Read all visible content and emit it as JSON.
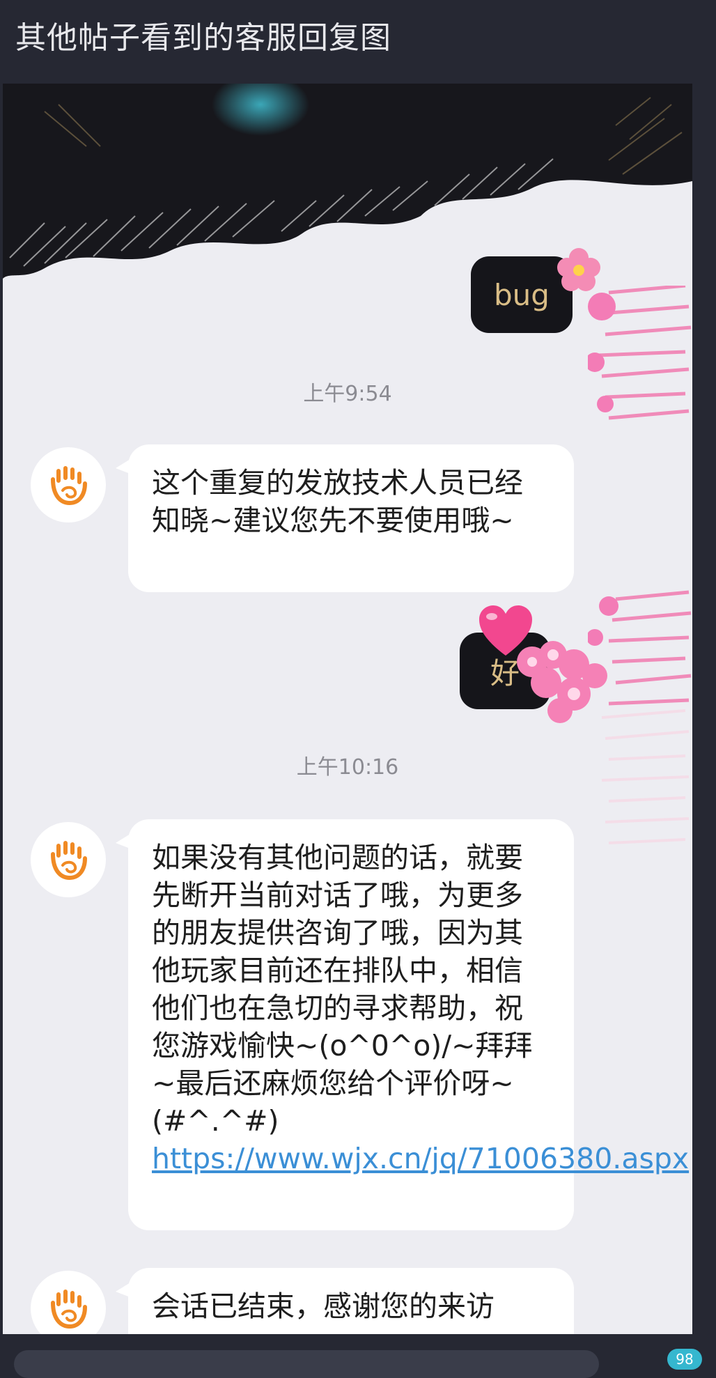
{
  "post": {
    "title": "其他帖子看到的客服回复图"
  },
  "chat": {
    "messages_out": [
      {
        "text": "bug"
      },
      {
        "text": "好"
      }
    ],
    "timestamps": [
      "上午9:54",
      "上午10:16"
    ],
    "agent_avatar": "orange-hand-logo-icon",
    "messages_in": [
      {
        "text": "这个重复的发放技术人员已经知晓~建议您先不要使用哦~"
      },
      {
        "text": "如果没有其他问题的话，就要先断开当前对话了哦，为更多的朋友提供咨询了哦，因为其他玩家目前还在排队中，相信他们也在急切的寻求帮助，祝您游戏愉快~(o^0^o)/~拜拜~最后还麻烦您给个评价呀~(#^.^#)",
        "link": "https://www.wjx.cn/jq/71006380.aspx"
      },
      {
        "text": "会话已结束，感谢您的来访"
      }
    ]
  },
  "footer": {
    "badge": "98"
  },
  "colors": {
    "page_bg": "#262833",
    "chat_bg": "#ededf2",
    "bubble_in": "#ffffff",
    "bubble_out": "#15151a",
    "bubble_out_text": "#d9bd86",
    "link": "#3b8fd6",
    "logo": "#f08a24"
  }
}
